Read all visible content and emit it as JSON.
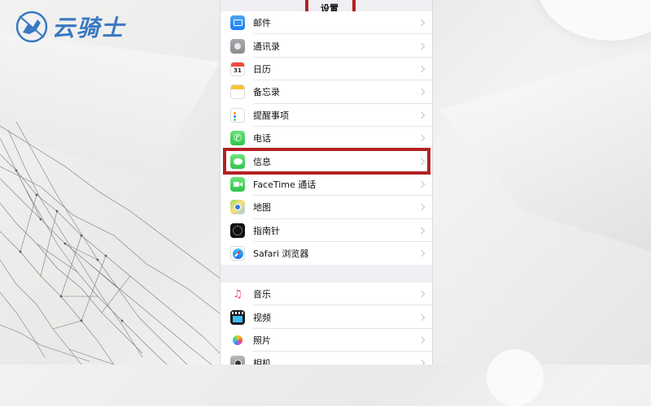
{
  "brand": {
    "name": "云骑士",
    "color": "#3b78c3"
  },
  "nav": {
    "title": "设置"
  },
  "highlight_color": "#b32222",
  "settings_group_1": [
    {
      "label": "邮件",
      "icon": "mail-icon"
    },
    {
      "label": "通讯录",
      "icon": "contacts-icon"
    },
    {
      "label": "日历",
      "icon": "calendar-icon"
    },
    {
      "label": "备忘录",
      "icon": "notes-icon"
    },
    {
      "label": "提醒事项",
      "icon": "reminders-icon"
    },
    {
      "label": "电话",
      "icon": "phone-icon"
    },
    {
      "label": "信息",
      "icon": "messages-icon",
      "highlighted": true
    },
    {
      "label": "FaceTime 通话",
      "icon": "facetime-icon"
    },
    {
      "label": "地图",
      "icon": "maps-icon"
    },
    {
      "label": "指南针",
      "icon": "compass-icon"
    },
    {
      "label": "Safari 浏览器",
      "icon": "safari-icon"
    }
  ],
  "settings_group_2": [
    {
      "label": "音乐",
      "icon": "music-icon"
    },
    {
      "label": "视频",
      "icon": "videos-icon"
    },
    {
      "label": "照片",
      "icon": "photos-icon"
    },
    {
      "label": "相机",
      "icon": "camera-icon"
    }
  ]
}
